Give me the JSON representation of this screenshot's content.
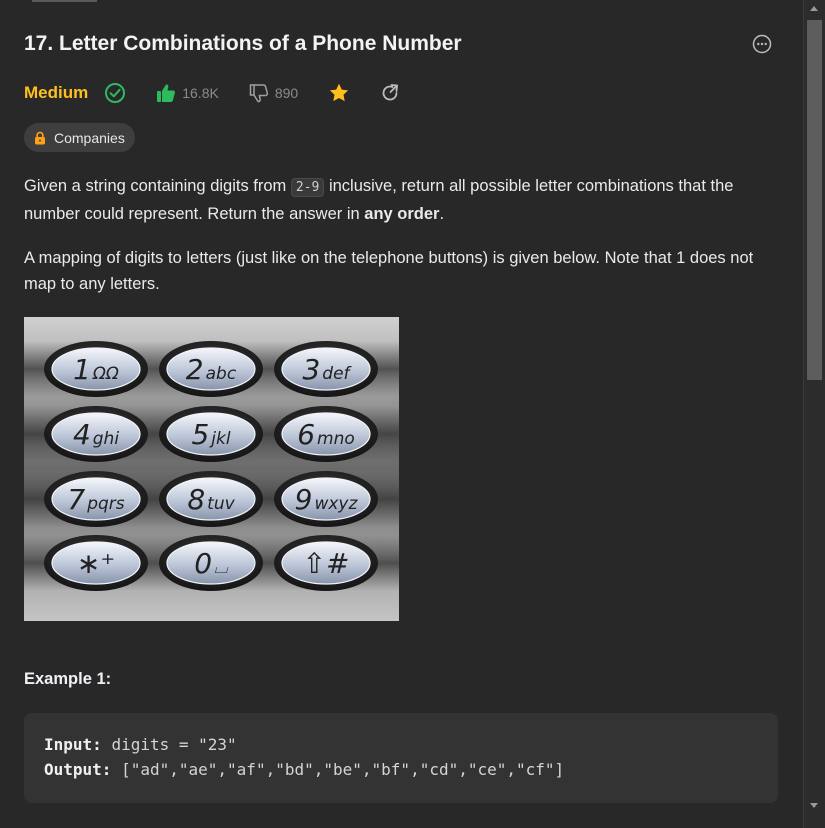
{
  "problem": {
    "title": "17. Letter Combinations of a Phone Number",
    "difficulty": "Medium",
    "likes": "16.8K",
    "dislikes": "890",
    "companies_label": "Companies"
  },
  "description": {
    "p1_before": "Given a string containing digits from ",
    "p1_code": "2-9",
    "p1_after": " inclusive, return all possible letter combinations that the number could represent. Return the answer in ",
    "p1_bold": "any order",
    "p1_end": ".",
    "p2": "A mapping of digits to letters (just like on the telephone buttons) is given below. Note that 1 does not map to any letters."
  },
  "keypad": {
    "keys": [
      {
        "digit": "1",
        "letters": "ΩΩ"
      },
      {
        "digit": "2",
        "letters": "abc"
      },
      {
        "digit": "3",
        "letters": "def"
      },
      {
        "digit": "4",
        "letters": "ghi"
      },
      {
        "digit": "5",
        "letters": "jkl"
      },
      {
        "digit": "6",
        "letters": "mno"
      },
      {
        "digit": "7",
        "letters": "pqrs"
      },
      {
        "digit": "8",
        "letters": "tuv"
      },
      {
        "digit": "9",
        "letters": "wxyz"
      },
      {
        "digit": "∗⁺",
        "letters": ""
      },
      {
        "digit": "0",
        "letters": "⌴"
      },
      {
        "digit": "⇧#",
        "letters": ""
      }
    ]
  },
  "example1": {
    "title": "Example 1:",
    "input_label": "Input:",
    "input_value": "digits = \"23\"",
    "output_label": "Output:",
    "output_value": "[\"ad\",\"ae\",\"af\",\"bd\",\"be\",\"bf\",\"cd\",\"ce\",\"cf\"]"
  },
  "colors": {
    "difficulty": "#ffc01e",
    "solved": "#2cbb5d",
    "like": "#2cbb5d",
    "star": "#ffc01e"
  }
}
